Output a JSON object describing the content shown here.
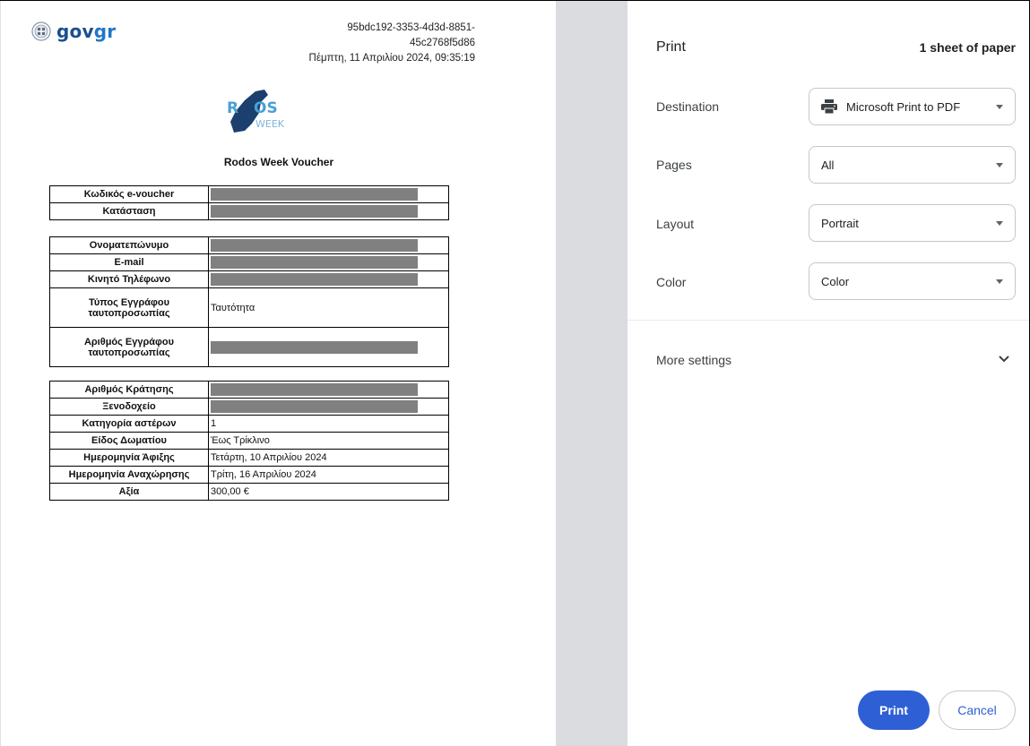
{
  "document": {
    "logo_text_main": "gov",
    "logo_text_accent": "gr",
    "doc_id_line1": "95bdc192-3353-4d3d-8851-",
    "doc_id_line2": "45c2768f5d86",
    "timestamp": "Πέμπτη, 11 Απριλίου 2024, 09:35:19",
    "event_logo_text": "RODOS WEEK",
    "title": "Rodos Week Voucher",
    "section1": [
      {
        "label": "Κωδικός e-voucher",
        "value": "",
        "redacted": true
      },
      {
        "label": "Κατάσταση",
        "value": "",
        "redacted": true
      }
    ],
    "section2": [
      {
        "label": "Ονοματεπώνυμο",
        "value": "",
        "redacted": true
      },
      {
        "label": "E-mail",
        "value": "",
        "redacted": true
      },
      {
        "label": "Κινητό Τηλέφωνο",
        "value": "",
        "redacted": true
      },
      {
        "label": "Τύπος Εγγράφου ταυτοπροσωπίας",
        "value": "Ταυτότητα",
        "redacted": false
      },
      {
        "label": "Αριθμός Εγγράφου ταυτοπροσωπίας",
        "value": "",
        "redacted": true
      }
    ],
    "section3": [
      {
        "label": "Αριθμός Κράτησης",
        "value": "",
        "redacted": true
      },
      {
        "label": "Ξενοδοχείο",
        "value": "",
        "redacted": true
      },
      {
        "label": "Κατηγορία αστέρων",
        "value": "1",
        "redacted": false
      },
      {
        "label": "Είδος Δωματίου",
        "value": "Έως Τρίκλινο",
        "redacted": false
      },
      {
        "label": "Ημερομηνία Άφιξης",
        "value": "Τετάρτη, 10 Απριλίου 2024",
        "redacted": false
      },
      {
        "label": "Ημερομηνία Αναχώρησης",
        "value": "Τρίτη, 16 Απριλίου 2024",
        "redacted": false
      },
      {
        "label": "Αξία",
        "value": "300,00 €",
        "redacted": false
      }
    ]
  },
  "panel": {
    "heading": "Print",
    "sheet_count": "1 sheet of paper",
    "destination_label": "Destination",
    "destination_value": "Microsoft Print to PDF",
    "pages_label": "Pages",
    "pages_value": "All",
    "layout_label": "Layout",
    "layout_value": "Portrait",
    "color_label": "Color",
    "color_value": "Color",
    "more_settings": "More settings",
    "print_button": "Print",
    "cancel_button": "Cancel"
  },
  "colors": {
    "accent": "#2f5fd4",
    "redaction": "#808080",
    "gutter": "#dadce0"
  }
}
